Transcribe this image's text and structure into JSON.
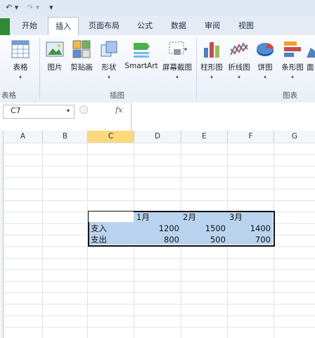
{
  "qat": {
    "undo": "↶ ▾",
    "redo": "↷ ▾",
    "more": "▾"
  },
  "tabs": [
    {
      "label": "开始"
    },
    {
      "label": "插入"
    },
    {
      "label": "页面布局"
    },
    {
      "label": "公式"
    },
    {
      "label": "数据"
    },
    {
      "label": "审阅"
    },
    {
      "label": "视图"
    }
  ],
  "ribbon": {
    "buttons": [
      {
        "label": "表格",
        "arrow": "▾"
      },
      {
        "label": "图片"
      },
      {
        "label": "剪贴画"
      },
      {
        "label": "形状",
        "arrow": "▾"
      },
      {
        "label": "SmartArt"
      },
      {
        "label": "屏幕截图",
        "arrow": "▾"
      },
      {
        "label": "柱形图",
        "arrow": "▾"
      },
      {
        "label": "折线图",
        "arrow": "▾"
      },
      {
        "label": "饼图",
        "arrow": "▾"
      },
      {
        "label": "条形图",
        "arrow": "▾"
      },
      {
        "label": "面"
      }
    ],
    "groups": {
      "tables": "表格",
      "illustrations": "插图",
      "charts": "图表"
    }
  },
  "formula_bar": {
    "name_box": "C7",
    "name_dd": "▾",
    "fx": "fx"
  },
  "columns": [
    "A",
    "B",
    "C",
    "D",
    "E",
    "F",
    "G"
  ],
  "sheet": {
    "header_row": [
      "1月",
      "2月",
      "3月"
    ],
    "rows": [
      {
        "label": "支入",
        "values": [
          "1200",
          "1500",
          "1400"
        ]
      },
      {
        "label": "支出",
        "values": [
          "800",
          "500",
          "700"
        ]
      }
    ]
  },
  "colors": {
    "selected_col": "#fbd97c",
    "range_fill": "#b9d3ef",
    "file_tab": "#2e8b35"
  }
}
